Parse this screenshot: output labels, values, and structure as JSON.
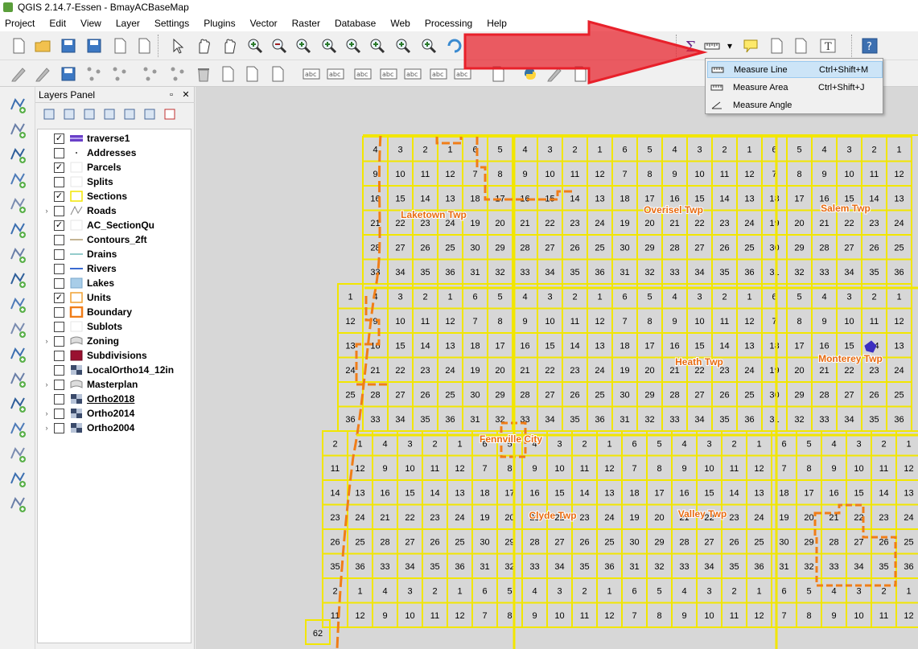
{
  "window": {
    "title": "QGIS 2.14.7-Essen - BmayACBaseMap"
  },
  "menubar": {
    "items": [
      "Project",
      "Edit",
      "View",
      "Layer",
      "Settings",
      "Plugins",
      "Vector",
      "Raster",
      "Database",
      "Web",
      "Processing",
      "Help"
    ]
  },
  "layers_panel": {
    "title": "Layers Panel",
    "layers": [
      {
        "name": "traverse1",
        "checked": true,
        "expandable": false,
        "symbol": "line-purple"
      },
      {
        "name": "Addresses",
        "checked": false,
        "expandable": false,
        "symbol": "point"
      },
      {
        "name": "Parcels",
        "checked": true,
        "expandable": false,
        "symbol": "fill-white"
      },
      {
        "name": "Splits",
        "checked": false,
        "expandable": false,
        "symbol": "fill-white"
      },
      {
        "name": "Sections",
        "checked": true,
        "expandable": false,
        "symbol": "fill-yellow-outline"
      },
      {
        "name": "Roads",
        "checked": false,
        "expandable": true,
        "symbol": "road"
      },
      {
        "name": "AC_SectionQu",
        "checked": true,
        "expandable": false,
        "symbol": "fill-white"
      },
      {
        "name": "Contours_2ft",
        "checked": false,
        "expandable": false,
        "symbol": "line-brown"
      },
      {
        "name": "Drains",
        "checked": false,
        "expandable": false,
        "symbol": "line-teal"
      },
      {
        "name": "Rivers",
        "checked": false,
        "expandable": false,
        "symbol": "line-blue"
      },
      {
        "name": "Lakes",
        "checked": false,
        "expandable": false,
        "symbol": "fill-lightblue"
      },
      {
        "name": "Units",
        "checked": true,
        "expandable": false,
        "symbol": "fill-orange-outline"
      },
      {
        "name": "Boundary",
        "checked": false,
        "expandable": false,
        "symbol": "fill-orange-thick"
      },
      {
        "name": "Sublots",
        "checked": false,
        "expandable": false,
        "symbol": "fill-white"
      },
      {
        "name": "Zoning",
        "checked": false,
        "expandable": true,
        "symbol": "zoning"
      },
      {
        "name": "Subdivisions",
        "checked": false,
        "expandable": false,
        "symbol": "fill-maroon"
      },
      {
        "name": "LocalOrtho14_12in",
        "checked": false,
        "expandable": false,
        "symbol": "raster"
      },
      {
        "name": "Masterplan",
        "checked": false,
        "expandable": true,
        "symbol": "zoning"
      },
      {
        "name": "Ortho2018",
        "checked": false,
        "expandable": false,
        "symbol": "raster",
        "underline": true
      },
      {
        "name": "Ortho2014",
        "checked": false,
        "expandable": true,
        "symbol": "raster"
      },
      {
        "name": "Ortho2004",
        "checked": false,
        "expandable": true,
        "symbol": "raster"
      }
    ]
  },
  "measure_menu": {
    "items": [
      {
        "label": "Measure Line",
        "shortcut": "Ctrl+Shift+M",
        "active": true
      },
      {
        "label": "Measure Area",
        "shortcut": "Ctrl+Shift+J",
        "active": false
      },
      {
        "label": "Measure Angle",
        "shortcut": "",
        "active": false
      }
    ]
  },
  "map": {
    "township_labels": [
      "Laketown Twp",
      "Overisel Twp",
      "Salem Twp",
      "Heath Twp",
      "Monterey Twp",
      "Fennville City",
      "Clyde Twp",
      "Valley Twp"
    ],
    "section_rows": [
      [
        "4",
        "3",
        "2",
        "1",
        "6",
        "5",
        "4",
        "3",
        "2",
        "1",
        "6",
        "5",
        "4",
        "3",
        "2",
        "1",
        "6",
        "5",
        "4",
        "3",
        "2",
        "1"
      ],
      [
        "9",
        "10",
        "11",
        "12",
        "7",
        "8",
        "9",
        "10",
        "11",
        "12",
        "7",
        "8",
        "9",
        "10",
        "11",
        "12",
        "7",
        "8",
        "9",
        "10",
        "11",
        "12"
      ],
      [
        "16",
        "15",
        "14",
        "13",
        "18",
        "17",
        "16",
        "15",
        "14",
        "13",
        "18",
        "17",
        "16",
        "15",
        "14",
        "13",
        "18",
        "17",
        "16",
        "15",
        "14",
        "13"
      ],
      [
        "21",
        "22",
        "23",
        "24",
        "19",
        "20",
        "21",
        "22",
        "23",
        "24",
        "19",
        "20",
        "21",
        "22",
        "23",
        "24",
        "19",
        "20",
        "21",
        "22",
        "23",
        "24"
      ],
      [
        "28",
        "27",
        "26",
        "25",
        "30",
        "29",
        "28",
        "27",
        "26",
        "25",
        "30",
        "29",
        "28",
        "27",
        "26",
        "25",
        "30",
        "29",
        "28",
        "27",
        "26",
        "25"
      ],
      [
        "33",
        "34",
        "35",
        "36",
        "31",
        "32",
        "33",
        "34",
        "35",
        "36",
        "31",
        "32",
        "33",
        "34",
        "35",
        "36",
        "31",
        "32",
        "33",
        "34",
        "35",
        "36"
      ]
    ],
    "row_62_label": "62",
    "colors": {
      "section_line": "#f2e600",
      "boundary": "#f07d18",
      "label": "#e86a10",
      "canvas_bg": "#d7d7d7",
      "traverse": "#3b2fc0"
    }
  },
  "annotation": {
    "arrow_color": "#e8202a"
  }
}
